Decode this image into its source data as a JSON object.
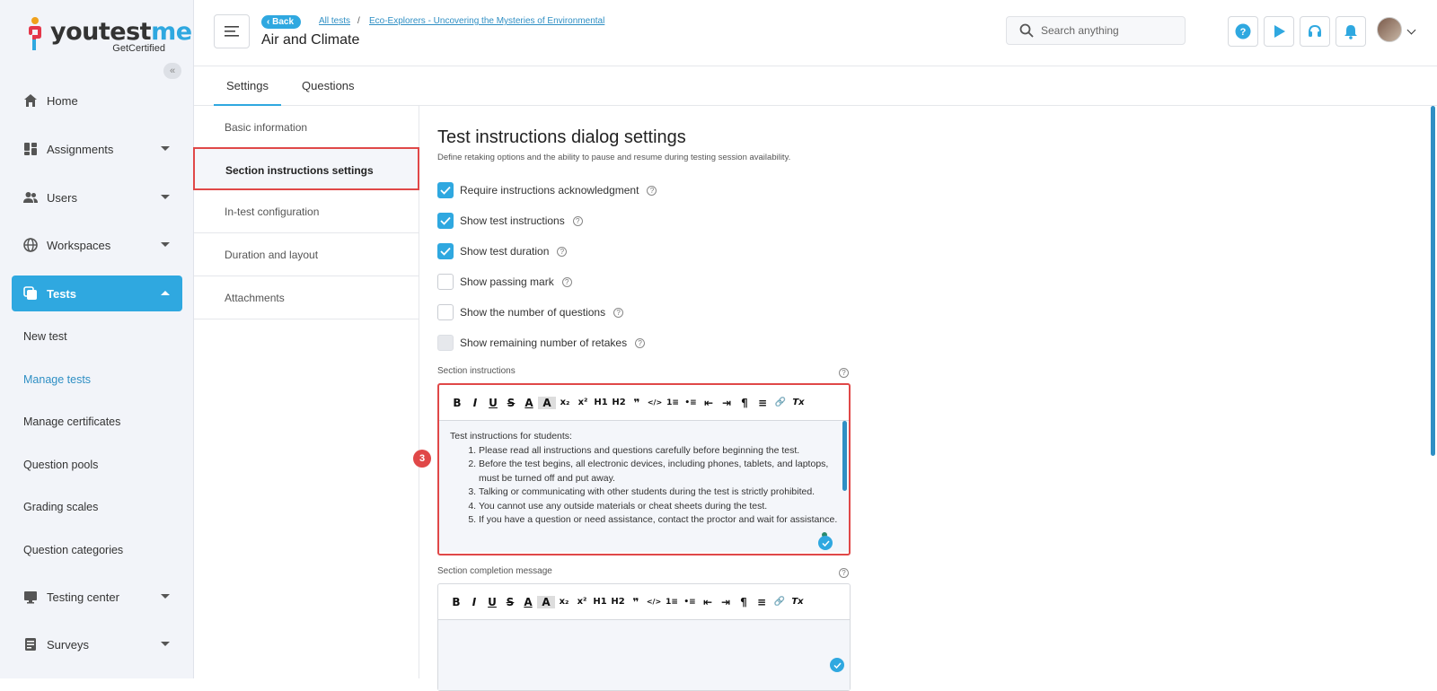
{
  "brand": {
    "name_prefix": "youtest",
    "name_suffix": "me",
    "tagline": "GetCertified"
  },
  "sidebar": {
    "items": [
      {
        "label": "Home",
        "icon": "home-icon"
      },
      {
        "label": "Assignments",
        "icon": "assignments-icon"
      },
      {
        "label": "Users",
        "icon": "users-icon"
      },
      {
        "label": "Workspaces",
        "icon": "globe-icon"
      },
      {
        "label": "Tests",
        "icon": "tests-icon"
      }
    ],
    "sub_items": [
      "New test",
      "Manage tests",
      "Manage certificates",
      "Question pools",
      "Grading scales",
      "Question categories"
    ],
    "bottom_items": [
      {
        "label": "Testing center",
        "icon": "monitor-icon"
      },
      {
        "label": "Surveys",
        "icon": "survey-icon"
      }
    ]
  },
  "header": {
    "back_label": "Back",
    "breadcrumb": [
      "All tests",
      "Eco-Explorers - Uncovering the Mysteries of Environmental"
    ],
    "separator": "/",
    "title": "Air and Climate",
    "search_placeholder": "Search anything"
  },
  "tabs": [
    "Settings",
    "Questions"
  ],
  "subnav": [
    "Basic information",
    "Section instructions settings",
    "In-test configuration",
    "Duration and layout",
    "Attachments"
  ],
  "main": {
    "title": "Test instructions dialog settings",
    "description": "Define retaking options and the ability to pause and resume during testing session availability.",
    "options": [
      {
        "label": "Require instructions acknowledgment",
        "checked": true
      },
      {
        "label": "Show test instructions",
        "checked": true
      },
      {
        "label": "Show test duration",
        "checked": true
      },
      {
        "label": "Show passing mark",
        "checked": false
      },
      {
        "label": "Show the number of questions",
        "checked": false
      },
      {
        "label": "Show remaining number of retakes",
        "checked": false,
        "disabled": true
      }
    ],
    "help_glyph": "?",
    "section_instructions_label": "Section instructions",
    "instructions_intro": "Test instructions for students:",
    "instructions_list": [
      "Please read all instructions and questions carefully before beginning the test.",
      "Before the test begins, all electronic devices, including phones, tablets, and laptops, must be turned off and put away.",
      "Talking or communicating with other students during the test is strictly prohibited.",
      "You cannot use any outside materials or cheat sheets during the test.",
      "If you have a question or need assistance, contact the proctor and wait for assistance."
    ],
    "completion_label": "Section completion message",
    "step_number": "3"
  },
  "toolbar_glyphs": [
    "B",
    "I",
    "U",
    "S",
    "A",
    "A",
    "x₂",
    "x²",
    "H1",
    "H2",
    "❞",
    "</>",
    "1≡",
    "•≡",
    "⇤",
    "⇥",
    "¶",
    "≡",
    "🔗",
    "Tx"
  ],
  "colors": {
    "accent": "#2fa8e0",
    "highlight": "#e04848",
    "link": "#2f8fc4"
  }
}
